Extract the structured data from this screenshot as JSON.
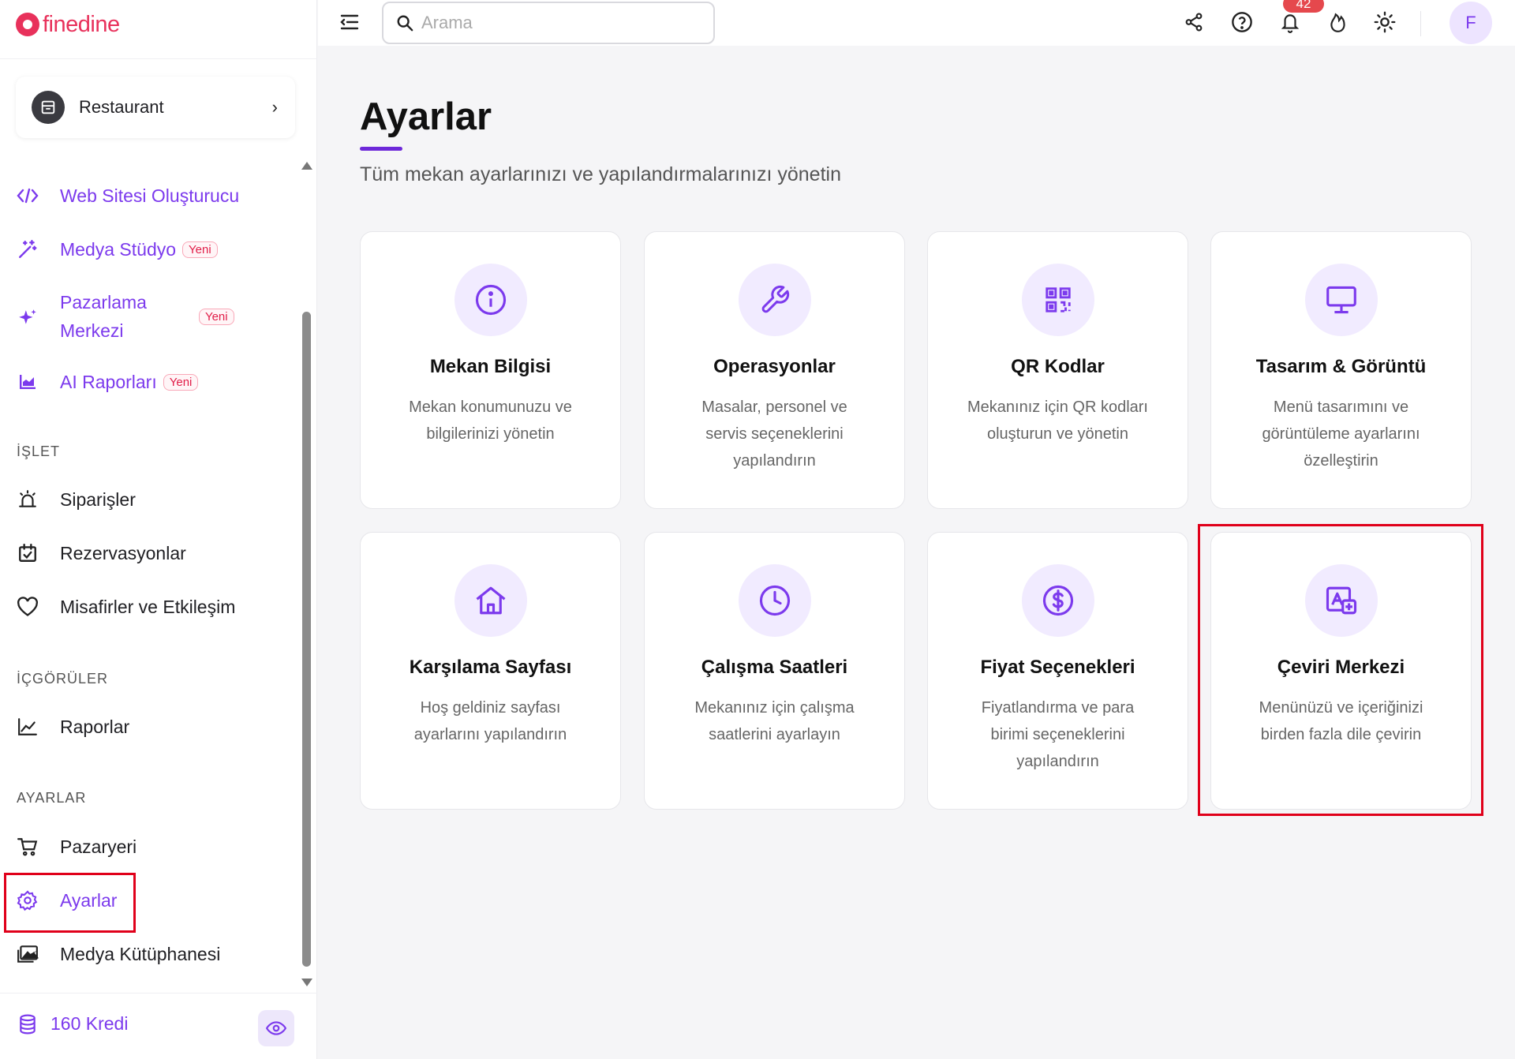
{
  "brand": {
    "name": "finedine",
    "color": "#e8315b",
    "accent": "#7c3aed"
  },
  "venue": {
    "name": "Restaurant",
    "icon": "store-icon"
  },
  "nav_top": [
    {
      "label": "Web Sitesi Oluşturucu",
      "icon": "code-icon",
      "badge": ""
    },
    {
      "label": "Medya Stüdyo",
      "icon": "magic-wand-icon",
      "badge": "Yeni"
    },
    {
      "label_line1": "Pazarlama",
      "label_line2": "Merkezi",
      "icon": "sparkles-icon",
      "badge": "Yeni"
    },
    {
      "label": "AI Raporları",
      "icon": "chart-icon",
      "badge": "Yeni"
    }
  ],
  "sections": {
    "operate": {
      "title": "İŞLET",
      "items": [
        {
          "label": "Siparişler",
          "icon": "alarm-icon"
        },
        {
          "label": "Rezervasyonlar",
          "icon": "calendar-check-icon"
        },
        {
          "label": "Misafirler ve Etkileşim",
          "icon": "heart-icon"
        }
      ]
    },
    "insights": {
      "title": "İÇGÖRÜLER",
      "items": [
        {
          "label": "Raporlar",
          "icon": "line-chart-icon"
        }
      ]
    },
    "settings": {
      "title": "AYARLAR",
      "items": [
        {
          "label": "Pazaryeri",
          "icon": "cart-icon"
        },
        {
          "label": "Ayarlar",
          "icon": "gear-icon"
        },
        {
          "label": "Medya Kütüphanesi",
          "icon": "images-icon"
        }
      ]
    }
  },
  "credits": {
    "label": "160 Kredi",
    "icon": "database-icon"
  },
  "topbar": {
    "search_placeholder": "Arama",
    "notification_count": "42",
    "avatar_initial": "F"
  },
  "page": {
    "title": "Ayarlar",
    "subtitle": "Tüm mekan ayarlarınızı ve yapılandırmalarınızı yönetin"
  },
  "cards": [
    {
      "title": "Mekan Bilgisi",
      "desc": "Mekan konumunuzu ve bilgilerinizi yönetin",
      "icon": "info-icon"
    },
    {
      "title": "Operasyonlar",
      "desc": "Masalar, personel ve servis seçeneklerini yapılandırın",
      "icon": "wrench-icon"
    },
    {
      "title": "QR Kodlar",
      "desc": "Mekanınız için QR kodları oluşturun ve yönetin",
      "icon": "qr-code-icon"
    },
    {
      "title": "Tasarım & Görüntü",
      "desc": "Menü tasarımını ve görüntüleme ayarlarını özelleştirin",
      "icon": "monitor-icon"
    },
    {
      "title": "Karşılama Sayfası",
      "desc": "Hoş geldiniz sayfası ayarlarını yapılandırın",
      "icon": "home-icon"
    },
    {
      "title": "Çalışma Saatleri",
      "desc": "Mekanınız için çalışma saatlerini ayarlayın",
      "icon": "clock-icon"
    },
    {
      "title": "Fiyat Seçenekleri",
      "desc": "Fiyatlandırma ve para birimi seçeneklerini yapılandırın",
      "icon": "dollar-icon"
    },
    {
      "title": "Çeviri Merkezi",
      "desc": "Menünüzü ve içeriğinizi birden fazla dile çevirin",
      "icon": "translate-icon"
    }
  ]
}
